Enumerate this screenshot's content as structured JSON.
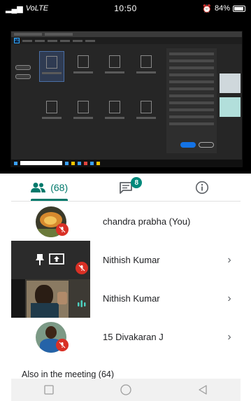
{
  "status_bar": {
    "carrier": "VoLTE",
    "time": "10:50",
    "battery": "84%"
  },
  "tabs": {
    "people_count": "(68)",
    "chat_badge": "8"
  },
  "participants": [
    {
      "name": "chandra prabha (You)",
      "muted": true,
      "has_menu": false,
      "avatar": "food-photo"
    },
    {
      "name": "Nithish Kumar",
      "muted": true,
      "has_menu": true,
      "avatar": "presenting"
    },
    {
      "name": "Nithish Kumar",
      "muted": false,
      "has_menu": true,
      "avatar": "video"
    },
    {
      "name": "15 Divakaran J",
      "muted": true,
      "has_menu": true,
      "avatar": "person-photo"
    }
  ],
  "also_in_meeting": "Also in the meeting (64)",
  "colors": {
    "accent": "#00796b",
    "mute": "#d93025",
    "badge": "#00897b"
  }
}
